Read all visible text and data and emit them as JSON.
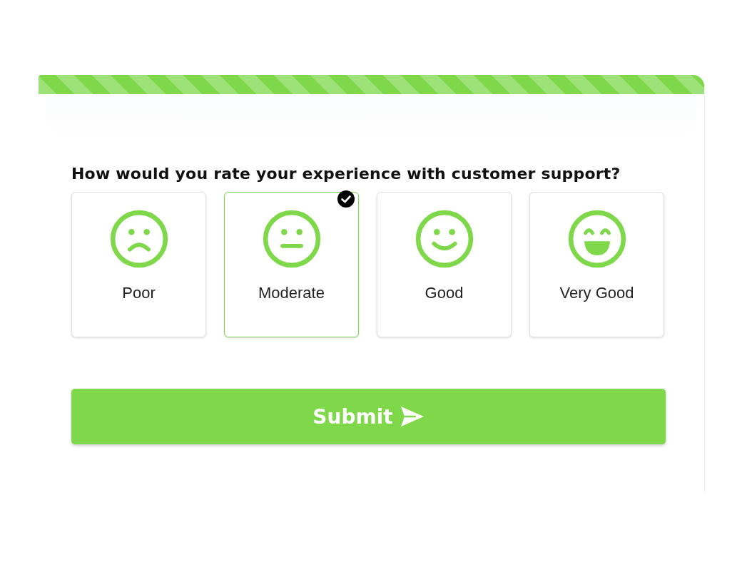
{
  "question": "How would you rate your experience with customer support?",
  "options": [
    {
      "kind": "sad",
      "label": "Poor",
      "selected": false
    },
    {
      "kind": "neutral",
      "label": "Moderate",
      "selected": true
    },
    {
      "kind": "smile",
      "label": "Good",
      "selected": false
    },
    {
      "kind": "laugh",
      "label": "Very Good",
      "selected": false
    }
  ],
  "submit": {
    "label": "Submit"
  }
}
